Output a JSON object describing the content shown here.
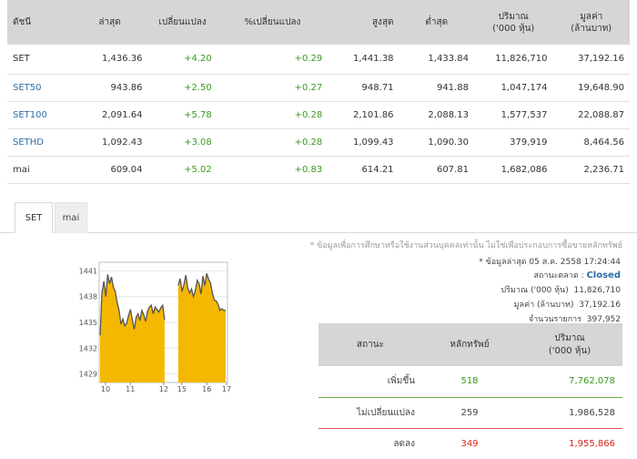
{
  "table": {
    "headers": [
      {
        "line1": "ดัชนี",
        "line2": ""
      },
      {
        "line1": "ล่าสุด",
        "line2": ""
      },
      {
        "line1": "เปลี่ยนแปลง",
        "line2": ""
      },
      {
        "line1": "%เปลี่ยนแปลง",
        "line2": ""
      },
      {
        "line1": "สูงสุด",
        "line2": ""
      },
      {
        "line1": "ต่ำสุด",
        "line2": ""
      },
      {
        "line1": "ปริมาณ",
        "line2": "('000 หุ้น)"
      },
      {
        "line1": "มูลค่า",
        "line2": "(ล้านบาท)"
      }
    ],
    "rows": [
      {
        "name": "SET",
        "last": "1,436.36",
        "change": "+4.20",
        "pct": "+0.29",
        "high": "1,441.38",
        "low": "1,433.84",
        "volume": "11,826,710",
        "value": "37,192.16"
      },
      {
        "name": "SET50",
        "last": "943.86",
        "change": "+2.50",
        "pct": "+0.27",
        "high": "948.71",
        "low": "941.88",
        "volume": "1,047,174",
        "value": "19,648.90"
      },
      {
        "name": "SET100",
        "last": "2,091.64",
        "change": "+5.78",
        "pct": "+0.28",
        "high": "2,101.86",
        "low": "2,088.13",
        "volume": "1,577,537",
        "value": "22,088.87"
      },
      {
        "name": "SETHD",
        "last": "1,092.43",
        "change": "+3.08",
        "pct": "+0.28",
        "high": "1,099.43",
        "low": "1,090.30",
        "volume": "379,919",
        "value": "8,464.56"
      },
      {
        "name": "mai",
        "last": "609.04",
        "change": "+5.02",
        "pct": "+0.83",
        "high": "614.21",
        "low": "607.81",
        "volume": "1,682,086",
        "value": "2,236.71"
      }
    ]
  },
  "tabs": {
    "set": "SET",
    "mai": "mai"
  },
  "chart_data": {
    "type": "area",
    "x_ticks": [
      "10",
      "11",
      "12",
      "15",
      "16",
      "17"
    ],
    "y_ticks": [
      1441,
      1438,
      1435,
      1432,
      1429
    ],
    "ylim": [
      1428,
      1442
    ],
    "session_gap_after_index": 34,
    "values": [
      1433.5,
      1438.5,
      1439.8,
      1438.0,
      1440.6,
      1439.5,
      1440.3,
      1439.1,
      1438.6,
      1437.3,
      1436.4,
      1434.8,
      1435.4,
      1434.6,
      1434.9,
      1435.8,
      1436.5,
      1435.3,
      1434.2,
      1435.6,
      1436.0,
      1435.2,
      1436.4,
      1435.9,
      1435.1,
      1436.3,
      1436.8,
      1437.0,
      1436.0,
      1436.8,
      1436.5,
      1436.2,
      1436.7,
      1437.0,
      1435.3,
      1439.3,
      1440.1,
      1438.6,
      1439.4,
      1440.5,
      1439.0,
      1438.4,
      1438.9,
      1438.0,
      1438.7,
      1439.9,
      1439.5,
      1438.3,
      1440.4,
      1439.3,
      1440.7,
      1440.0,
      1439.6,
      1438.4,
      1437.6,
      1437.5,
      1437.1,
      1436.4,
      1436.6,
      1436.4,
      1436.4
    ],
    "fill_color": "#f5b800",
    "line_color": "#555555"
  },
  "info": {
    "note": "* ข้อมูลเพื่อการศึกษาหรือใช้งานส่วนบุคคลเท่านั้น ไม่ใช่เพื่อประกอบการซื้อขายหลักทรัพย์",
    "updated": "* ข้อมูลล่าสุด 05 ส.ค. 2558 17:24:44",
    "status_label": "สถานะตลาด :",
    "status_value": "Closed",
    "volume_label": "ปริมาณ ('000 หุ้น)",
    "volume_value": "11,826,710",
    "value_label": "มูลค่า (ล้านบาท)",
    "value_value": "37,192.16",
    "trades_label": "จำนวนรายการ",
    "trades_value": "397,952"
  },
  "breadth": {
    "headers": {
      "status": "สถานะ",
      "count": "หลักทรัพย์",
      "volume_l1": "ปริมาณ",
      "volume_l2": "('000 หุ้น)"
    },
    "rows": [
      {
        "label": "เพิ่มขึ้น",
        "count": "518",
        "volume": "7,762,078"
      },
      {
        "label": "ไม่เปลี่ยนแปลง",
        "count": "259",
        "volume": "1,986,528"
      },
      {
        "label": "ลดลง",
        "count": "349",
        "volume": "1,955,866"
      }
    ]
  }
}
